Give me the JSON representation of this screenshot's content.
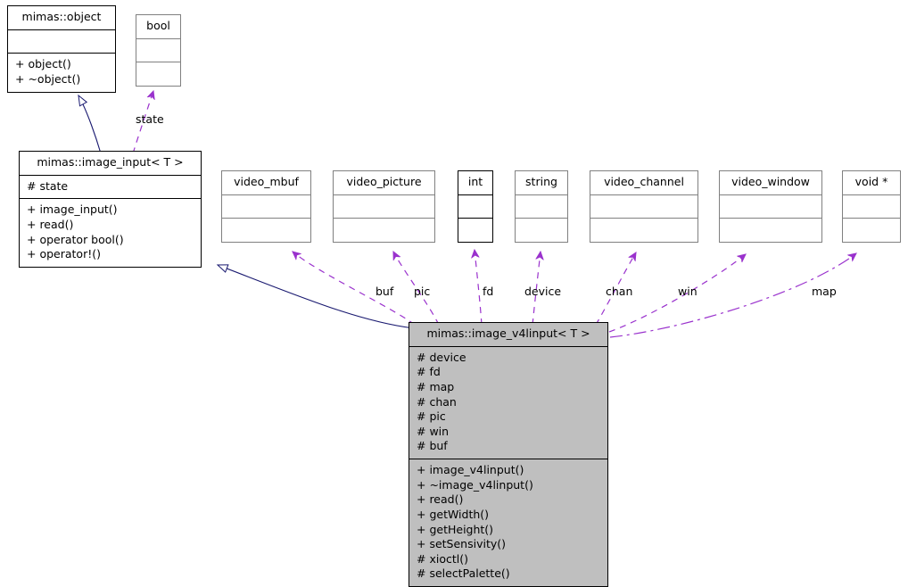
{
  "diagram": {
    "kind": "uml-class-collaboration-diagram",
    "colors": {
      "background": "#ffffff",
      "node_border": "#000000",
      "plain_node_border": "#808080",
      "filled_node_fill": "#bfbfbf",
      "inheritance_edge": "#191970",
      "usage_edge": "#9a32cd",
      "text": "#000000"
    }
  },
  "nodes": {
    "object": {
      "title": "mimas::object",
      "attributes": [],
      "operations": [
        "+ object()",
        "+ ~object()"
      ]
    },
    "bool": {
      "title": "bool",
      "attributes": [],
      "operations": []
    },
    "image_input": {
      "title": "mimas::image_input< T >",
      "attributes": [
        "# state"
      ],
      "operations": [
        "+ image_input()",
        "+ read()",
        "+ operator bool()",
        "+ operator!()"
      ]
    },
    "video_mbuf": {
      "title": "video_mbuf",
      "attributes": [],
      "operations": []
    },
    "video_picture": {
      "title": "video_picture",
      "attributes": [],
      "operations": []
    },
    "int": {
      "title": "int",
      "attributes": [],
      "operations": []
    },
    "string": {
      "title": "string",
      "attributes": [],
      "operations": []
    },
    "video_channel": {
      "title": "video_channel",
      "attributes": [],
      "operations": []
    },
    "video_window": {
      "title": "video_window",
      "attributes": [],
      "operations": []
    },
    "void_ptr": {
      "title": "void *",
      "attributes": [],
      "operations": []
    },
    "image_v4linput": {
      "title": "mimas::image_v4linput< T >",
      "attributes": [
        "# device",
        "# fd",
        "# map",
        "# chan",
        "# pic",
        "# win",
        "# buf"
      ],
      "operations": [
        "+ image_v4linput()",
        "+ ~image_v4linput()",
        "+ read()",
        "+ getWidth()",
        "+ getHeight()",
        "+ setSensivity()",
        "# xioctl()",
        "# selectPalette()"
      ]
    }
  },
  "edge_labels": {
    "state": "state",
    "buf": "buf",
    "pic": "pic",
    "fd": "fd",
    "device": "device",
    "chan": "chan",
    "win": "win",
    "map": "map"
  }
}
